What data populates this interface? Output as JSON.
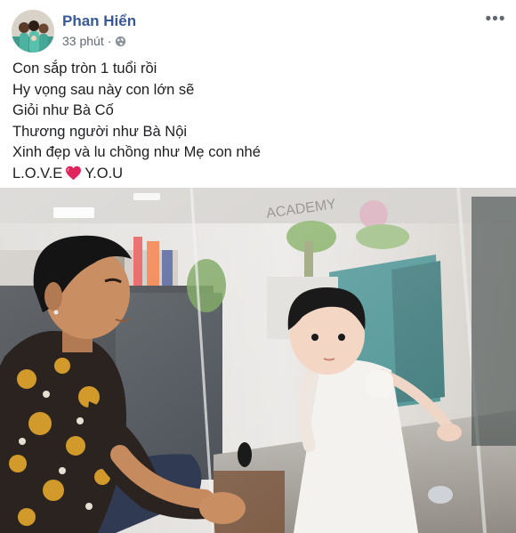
{
  "post": {
    "author": "Phan Hiển",
    "time": "33 phút",
    "privacy_icon": "globe-icon",
    "more_icon": "more-options-icon",
    "more_label": "•••"
  },
  "content": {
    "lines": [
      "Con sắp tròn 1 tuổi rồi",
      "Hy vọng sau này con lớn sẽ",
      "Giỏi như Bà Cố",
      "Thương người như Bà Nội",
      "Xinh đẹp và lu chồng như Mẹ con nhé"
    ],
    "love_before": "L.O.V.E",
    "love_after": "Y.O.U",
    "heart_icon": "red-heart-icon",
    "heart_color": "#e0245e"
  },
  "photo": {
    "sign_text": "ACADEMY"
  },
  "colors": {
    "author_name": "#385898",
    "meta_text": "#606770",
    "body_text": "#1c1e21"
  }
}
